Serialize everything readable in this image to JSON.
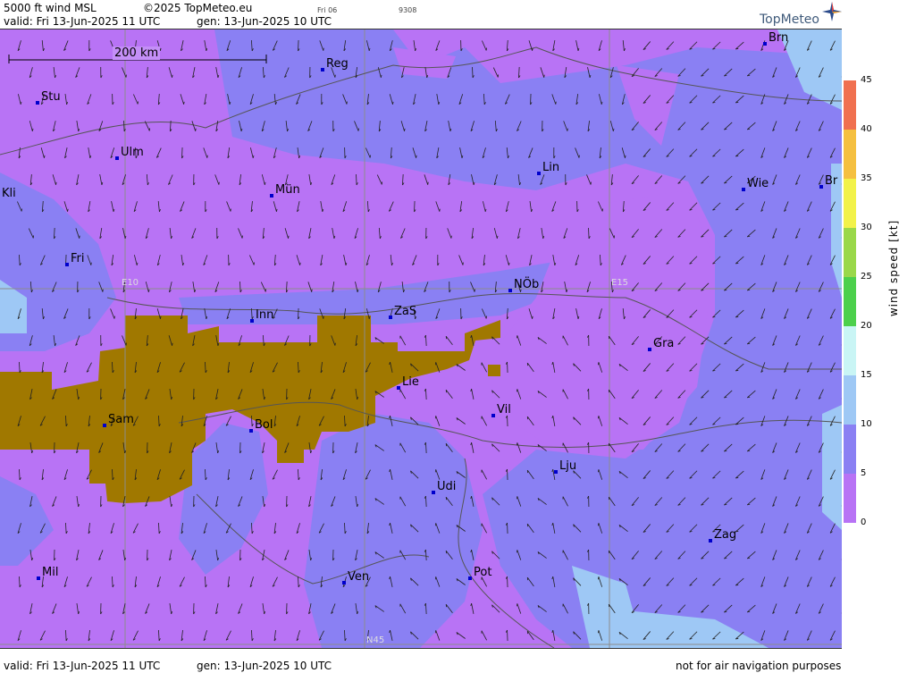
{
  "header": {
    "title": "5000 ft wind MSL",
    "copyright": "©2025 TopMeteo.eu",
    "frame_day": "Fri 06",
    "frame_code": "9308",
    "valid": "valid:  Fri  13-Jun-2025  11 UTC",
    "gen": "gen: 13-Jun-2025 10 UTC"
  },
  "footer": {
    "valid": "valid:  Fri  13-Jun-2025  11 UTC",
    "gen": "gen: 13-Jun-2025 10 UTC",
    "disclaimer": "not for air navigation purposes"
  },
  "logo": {
    "text": "TopMeteo",
    "icon": "star-compass-icon"
  },
  "scale_bar": {
    "label": "200 km"
  },
  "grid_labels": {
    "e10": "E10",
    "e15": "E15",
    "n45": "N45"
  },
  "cities": [
    {
      "id": "stu",
      "label": "Stu"
    },
    {
      "id": "ulm",
      "label": "Ulm"
    },
    {
      "id": "kli",
      "label": "Kli"
    },
    {
      "id": "fri",
      "label": "Fri"
    },
    {
      "id": "reg",
      "label": "Reg"
    },
    {
      "id": "mun",
      "label": "Mün"
    },
    {
      "id": "lin",
      "label": "Lin"
    },
    {
      "id": "brn",
      "label": "Brn"
    },
    {
      "id": "wie",
      "label": "Wie"
    },
    {
      "id": "br",
      "label": "Br"
    },
    {
      "id": "inn",
      "label": "Inn"
    },
    {
      "id": "zas",
      "label": "ZaS"
    },
    {
      "id": "nob",
      "label": "NÖb"
    },
    {
      "id": "gra",
      "label": "Gra"
    },
    {
      "id": "lie",
      "label": "Lie"
    },
    {
      "id": "vil",
      "label": "Vil"
    },
    {
      "id": "sam",
      "label": "Sam"
    },
    {
      "id": "bol",
      "label": "Bol"
    },
    {
      "id": "lju",
      "label": "Lju"
    },
    {
      "id": "udi",
      "label": "Udi"
    },
    {
      "id": "zag",
      "label": "Zag"
    },
    {
      "id": "mil",
      "label": "Mil"
    },
    {
      "id": "ven",
      "label": "Ven"
    },
    {
      "id": "pot",
      "label": "Pot"
    }
  ],
  "legend": {
    "title": "wind  speed  [kt]",
    "ticks": [
      "45",
      "40",
      "35",
      "30",
      "25",
      "20",
      "15",
      "10",
      "5",
      "0"
    ],
    "colors": {
      "0-5": "#b873f5",
      "5-10": "#8a80f3",
      "10-15": "#9ec8f5",
      "15-20": "#c9f5f5",
      "20-25": "#4cd04c",
      "25-30": "#9ad84a",
      "30-35": "#f2f24a",
      "35-40": "#f5c040",
      "40-45": "#f07050"
    }
  },
  "map_colors": {
    "terrain_above": "#a07800",
    "light_band": "#c48ff7",
    "blue_band": "#8a80f3",
    "sky": "#9ec8f5"
  }
}
